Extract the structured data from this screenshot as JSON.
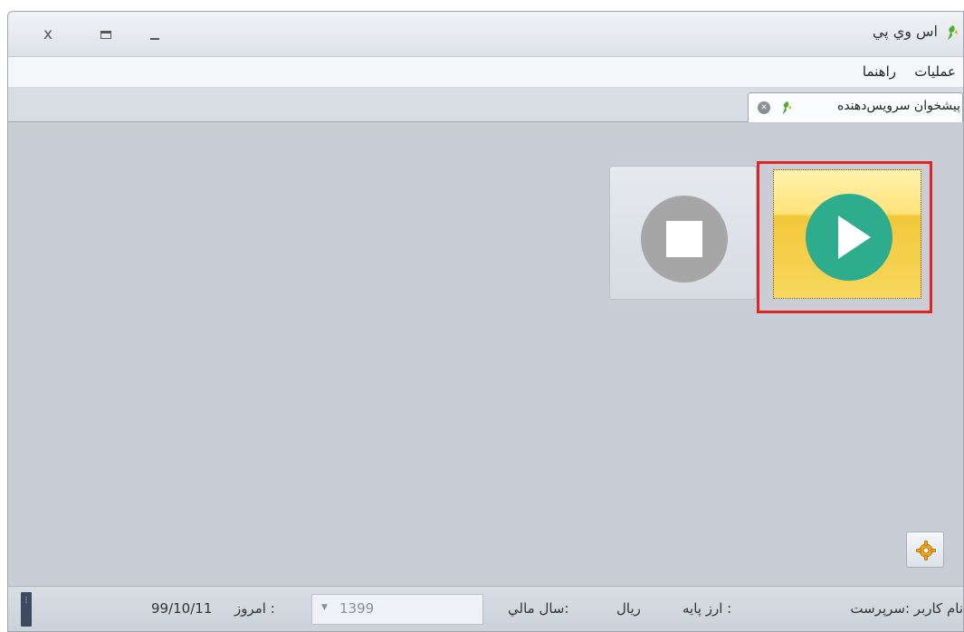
{
  "window": {
    "title": "اس وي پي",
    "logo_icon": "svp-logo-icon",
    "controls": {
      "close": "x"
    }
  },
  "menu": {
    "items": [
      {
        "label": "عمليات"
      },
      {
        "label": "راهنما"
      }
    ]
  },
  "tabs": [
    {
      "label": "پيشخوان سرويس‌دهنده",
      "active": true
    }
  ],
  "main": {
    "stop_button": {
      "icon": "stop-icon",
      "state": "disabled"
    },
    "start_button": {
      "icon": "play-icon",
      "state": "hover",
      "highlighted": true
    },
    "settings_button": {
      "icon": "settings-gear-icon"
    }
  },
  "status": {
    "user_label": "نام کاربر :سرپرست",
    "currency_label": "ارز پايه :",
    "currency_value": "ريال",
    "fiscal_year_label": "سال مالي:",
    "fiscal_year_value": "1399",
    "today_label": "امروز :",
    "today_value": "99/10/11"
  },
  "colors": {
    "accent_play": "#2dad8e",
    "stop_gray": "#a6a6a6",
    "highlight_red": "#e02424",
    "hover_yellow": "#ffe27a"
  }
}
